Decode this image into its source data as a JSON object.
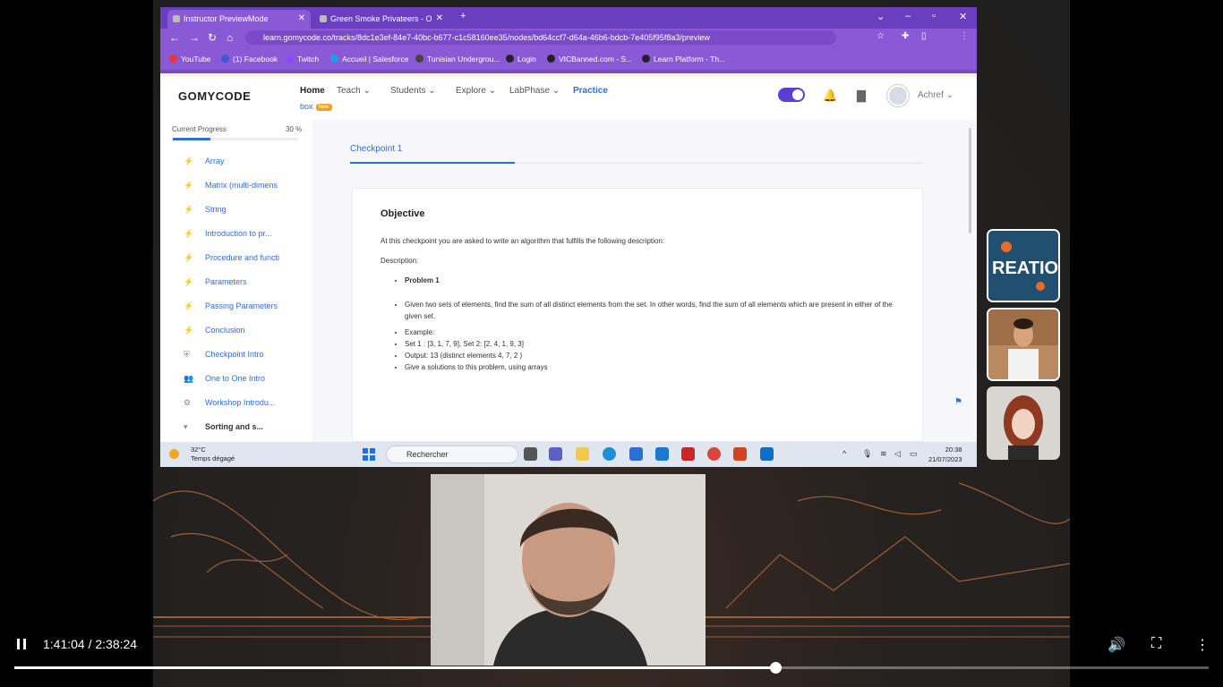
{
  "browser": {
    "tabs": [
      {
        "label": "Instructor PreviewMode",
        "active": true
      },
      {
        "label": "Green Smoke Privateers - O",
        "active": false
      }
    ],
    "url": "learn.gomycode.co/tracks/8dc1e3ef-84e7-40bc-b677-c1c58160ee35/nodes/bd64ccf7-d64a-46b6-bdcb-7e405f95f8a3/preview",
    "bookmarks": [
      "YouTube",
      "(1) Facebook",
      "Twitch",
      "Accueil | Salesforce",
      "Tunisian Undergrou...",
      "Login",
      "VICBanned.com - S...",
      "Learn Platform - Th..."
    ]
  },
  "app": {
    "logo": "GOMYCODE",
    "nav": [
      "Home",
      "Teach",
      "Students",
      "Explore",
      "LabPhase",
      "Practice"
    ],
    "practice_sub": "box",
    "badge": "New",
    "user": "Achref"
  },
  "sidebar": {
    "progress_label": "Current Progress",
    "progress_value": "30 %",
    "progress": 0.3,
    "items": [
      {
        "label": "Array"
      },
      {
        "label": "Matrix (multi-dimens"
      },
      {
        "label": "String"
      },
      {
        "label": "Introduction to pr..."
      },
      {
        "label": "Procedure and functi"
      },
      {
        "label": "Parameters"
      },
      {
        "label": "Passing Parameters"
      },
      {
        "label": "Conclusion"
      },
      {
        "label": "Checkpoint Intro"
      },
      {
        "label": "One to One Intro"
      },
      {
        "label": "Workshop Introdu..."
      },
      {
        "label": "Sorting and s..."
      }
    ]
  },
  "content": {
    "tab": "Checkpoint 1",
    "heading": "Objective",
    "intro": "At this checkpoint you are asked to write an algorithm that fulfills the following description:",
    "desc_label": "Description:",
    "problem": "Problem 1",
    "bullets": [
      "Given two sets of elements, find the sum of all distinct elements from the set. In other words, find the sum of all elements which are present in either of the given set.",
      "Example:",
      "Set 1 : [3, 1, 7, 9], Set 2: [2, 4, 1, 9, 3]",
      "Output: 13 (distinct elements 4, 7, 2 )",
      "Give a solutions to this problem, using arrays"
    ]
  },
  "taskbar": {
    "temp": "32°C",
    "weather": "Temps dégagé",
    "search": "Rechercher",
    "time": "20:38",
    "date": "21/07/2023"
  },
  "thumbnail_text": "REATIO",
  "player": {
    "current": "1:41:04",
    "duration": "2:38:24",
    "time_text": "1:41:04 / 2:38:24",
    "progress": 0.637
  }
}
